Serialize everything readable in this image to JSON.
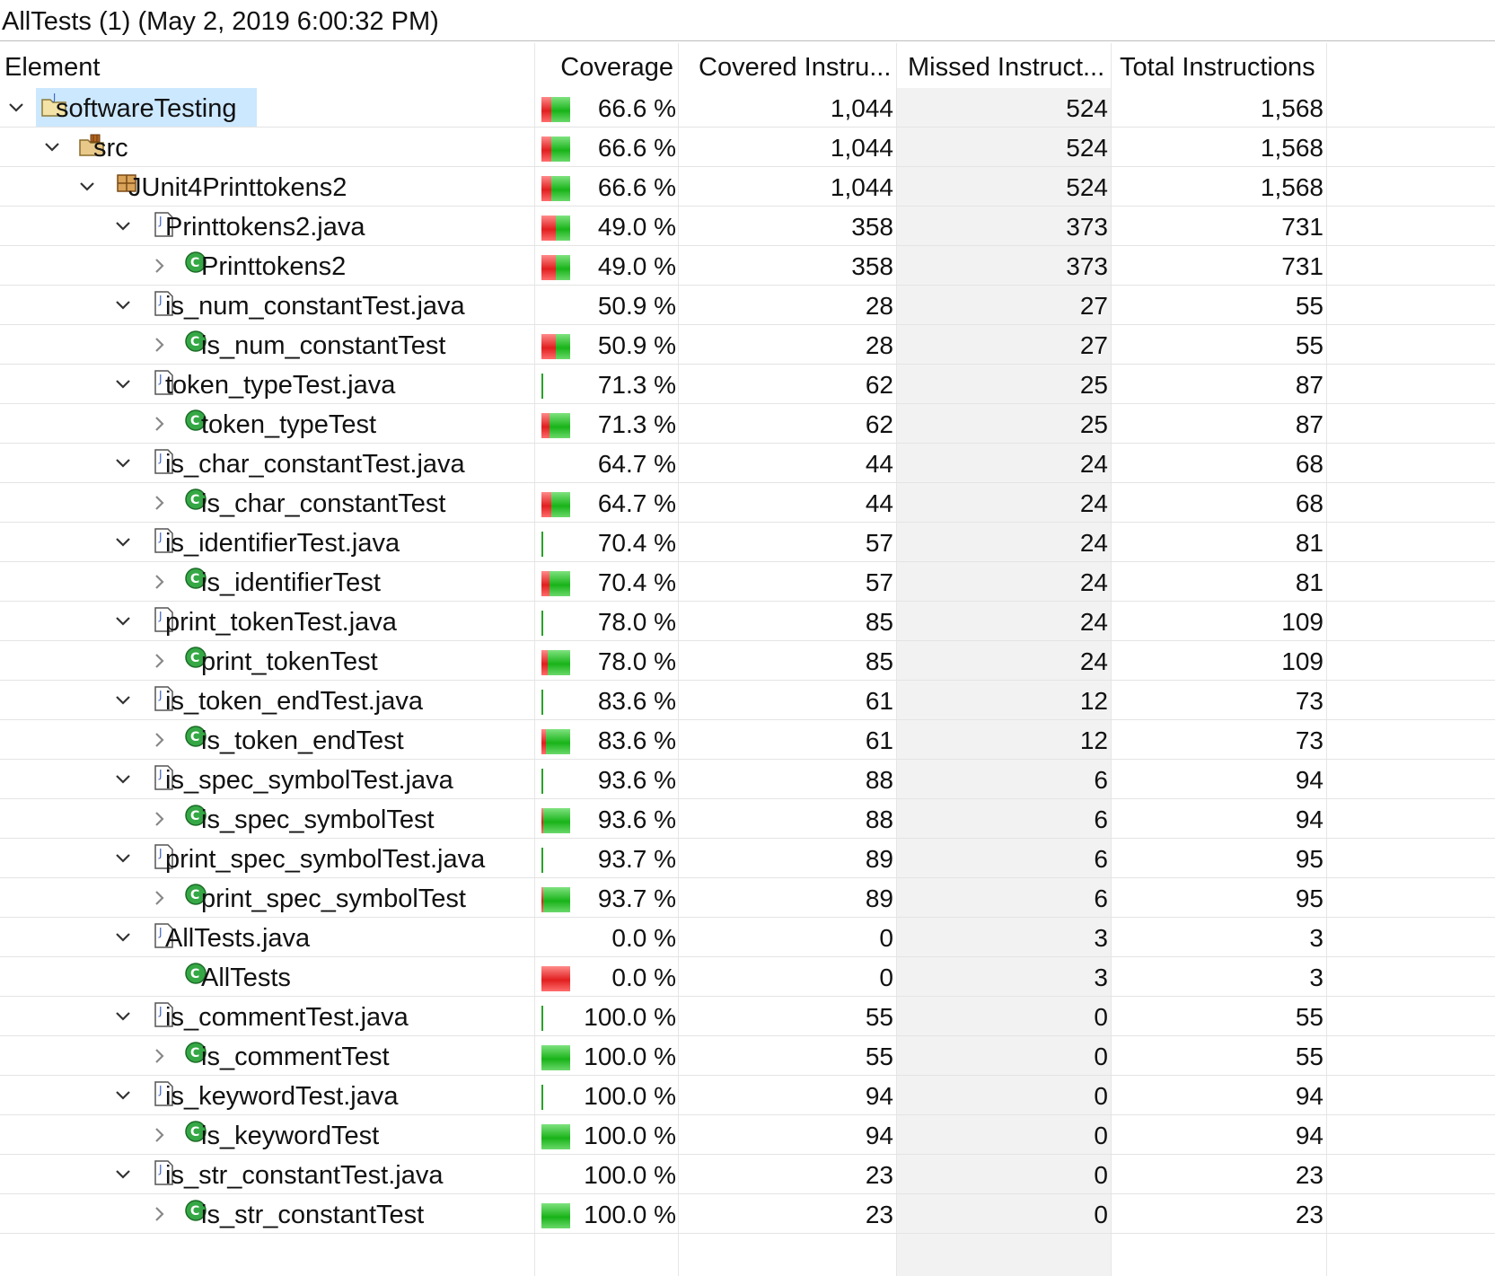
{
  "title": "AllTests (1) (May 2, 2019 6:00:32 PM)",
  "columns": {
    "element": "Element",
    "coverage": "Coverage",
    "covered": "Covered Instru...",
    "missed": "Missed Instruct...",
    "total": "Total Instructions"
  },
  "rows": [
    {
      "name": "softwareTesting",
      "kind": "project",
      "level": 0,
      "expander": "expanded",
      "selected": true,
      "bar": "full",
      "coverage_value": 66.6,
      "coverage": "66.6 %",
      "covered": "1,044",
      "missed": "524",
      "total": "1,568"
    },
    {
      "name": "src",
      "kind": "srcfolder",
      "level": 1,
      "expander": "expanded",
      "bar": "full",
      "coverage_value": 66.6,
      "coverage": "66.6 %",
      "covered": "1,044",
      "missed": "524",
      "total": "1,568"
    },
    {
      "name": "JUnit4Printtokens2",
      "kind": "package",
      "level": 2,
      "expander": "expanded",
      "bar": "full",
      "coverage_value": 66.6,
      "coverage": "66.6 %",
      "covered": "1,044",
      "missed": "524",
      "total": "1,568"
    },
    {
      "name": "Printtokens2.java",
      "kind": "javafile",
      "level": 3,
      "expander": "expanded",
      "bar": "full",
      "coverage_value": 49.0,
      "coverage": "49.0 %",
      "covered": "358",
      "missed": "373",
      "total": "731"
    },
    {
      "name": "Printtokens2",
      "kind": "class",
      "level": 4,
      "expander": "collapsed",
      "bar": "full",
      "coverage_value": 49.0,
      "coverage": "49.0 %",
      "covered": "358",
      "missed": "373",
      "total": "731"
    },
    {
      "name": "is_num_constantTest.java",
      "kind": "javafile",
      "level": 3,
      "expander": "expanded",
      "bar": "none",
      "coverage_value": 50.9,
      "coverage": "50.9 %",
      "covered": "28",
      "missed": "27",
      "total": "55"
    },
    {
      "name": "is_num_constantTest",
      "kind": "class",
      "level": 4,
      "expander": "collapsed",
      "bar": "full",
      "coverage_value": 50.9,
      "coverage": "50.9 %",
      "covered": "28",
      "missed": "27",
      "total": "55"
    },
    {
      "name": "token_typeTest.java",
      "kind": "javafile",
      "level": 3,
      "expander": "expanded",
      "bar": "thin",
      "coverage_value": 71.3,
      "coverage": "71.3 %",
      "covered": "62",
      "missed": "25",
      "total": "87"
    },
    {
      "name": "token_typeTest",
      "kind": "class",
      "level": 4,
      "expander": "collapsed",
      "bar": "full",
      "coverage_value": 71.3,
      "coverage": "71.3 %",
      "covered": "62",
      "missed": "25",
      "total": "87"
    },
    {
      "name": "is_char_constantTest.java",
      "kind": "javafile",
      "level": 3,
      "expander": "expanded",
      "bar": "none",
      "coverage_value": 64.7,
      "coverage": "64.7 %",
      "covered": "44",
      "missed": "24",
      "total": "68"
    },
    {
      "name": "is_char_constantTest",
      "kind": "class",
      "level": 4,
      "expander": "collapsed",
      "bar": "full",
      "coverage_value": 64.7,
      "coverage": "64.7 %",
      "covered": "44",
      "missed": "24",
      "total": "68"
    },
    {
      "name": "is_identifierTest.java",
      "kind": "javafile",
      "level": 3,
      "expander": "expanded",
      "bar": "thin",
      "coverage_value": 70.4,
      "coverage": "70.4 %",
      "covered": "57",
      "missed": "24",
      "total": "81"
    },
    {
      "name": "is_identifierTest",
      "kind": "class",
      "level": 4,
      "expander": "collapsed",
      "bar": "full",
      "coverage_value": 70.4,
      "coverage": "70.4 %",
      "covered": "57",
      "missed": "24",
      "total": "81"
    },
    {
      "name": "print_tokenTest.java",
      "kind": "javafile",
      "level": 3,
      "expander": "expanded",
      "bar": "thin",
      "coverage_value": 78.0,
      "coverage": "78.0 %",
      "covered": "85",
      "missed": "24",
      "total": "109"
    },
    {
      "name": "print_tokenTest",
      "kind": "class",
      "level": 4,
      "expander": "collapsed",
      "bar": "full",
      "coverage_value": 78.0,
      "coverage": "78.0 %",
      "covered": "85",
      "missed": "24",
      "total": "109"
    },
    {
      "name": "is_token_endTest.java",
      "kind": "javafile",
      "level": 3,
      "expander": "expanded",
      "bar": "thin",
      "coverage_value": 83.6,
      "coverage": "83.6 %",
      "covered": "61",
      "missed": "12",
      "total": "73"
    },
    {
      "name": "is_token_endTest",
      "kind": "class",
      "level": 4,
      "expander": "collapsed",
      "bar": "full",
      "coverage_value": 83.6,
      "coverage": "83.6 %",
      "covered": "61",
      "missed": "12",
      "total": "73"
    },
    {
      "name": "is_spec_symbolTest.java",
      "kind": "javafile",
      "level": 3,
      "expander": "expanded",
      "bar": "thin",
      "coverage_value": 93.6,
      "coverage": "93.6 %",
      "covered": "88",
      "missed": "6",
      "total": "94"
    },
    {
      "name": "is_spec_symbolTest",
      "kind": "class",
      "level": 4,
      "expander": "collapsed",
      "bar": "full",
      "coverage_value": 93.6,
      "coverage": "93.6 %",
      "covered": "88",
      "missed": "6",
      "total": "94"
    },
    {
      "name": "print_spec_symbolTest.java",
      "kind": "javafile",
      "level": 3,
      "expander": "expanded",
      "bar": "thin",
      "coverage_value": 93.7,
      "coverage": "93.7 %",
      "covered": "89",
      "missed": "6",
      "total": "95"
    },
    {
      "name": "print_spec_symbolTest",
      "kind": "class",
      "level": 4,
      "expander": "collapsed",
      "bar": "full",
      "coverage_value": 93.7,
      "coverage": "93.7 %",
      "covered": "89",
      "missed": "6",
      "total": "95"
    },
    {
      "name": "AllTests.java",
      "kind": "javafile",
      "level": 3,
      "expander": "expanded",
      "bar": "none",
      "coverage_value": 0.0,
      "coverage": "0.0 %",
      "covered": "0",
      "missed": "3",
      "total": "3"
    },
    {
      "name": "AllTests",
      "kind": "class",
      "level": 4,
      "expander": "none",
      "bar": "full",
      "coverage_value": 0.0,
      "coverage": "0.0 %",
      "covered": "0",
      "missed": "3",
      "total": "3"
    },
    {
      "name": "is_commentTest.java",
      "kind": "javafile",
      "level": 3,
      "expander": "expanded",
      "bar": "thin",
      "coverage_value": 100.0,
      "coverage": "100.0 %",
      "covered": "55",
      "missed": "0",
      "total": "55"
    },
    {
      "name": "is_commentTest",
      "kind": "class",
      "level": 4,
      "expander": "collapsed",
      "bar": "full",
      "coverage_value": 100.0,
      "coverage": "100.0 %",
      "covered": "55",
      "missed": "0",
      "total": "55"
    },
    {
      "name": "is_keywordTest.java",
      "kind": "javafile",
      "level": 3,
      "expander": "expanded",
      "bar": "thin",
      "coverage_value": 100.0,
      "coverage": "100.0 %",
      "covered": "94",
      "missed": "0",
      "total": "94"
    },
    {
      "name": "is_keywordTest",
      "kind": "class",
      "level": 4,
      "expander": "collapsed",
      "bar": "full",
      "coverage_value": 100.0,
      "coverage": "100.0 %",
      "covered": "94",
      "missed": "0",
      "total": "94"
    },
    {
      "name": "is_str_constantTest.java",
      "kind": "javafile",
      "level": 3,
      "expander": "expanded",
      "bar": "none",
      "coverage_value": 100.0,
      "coverage": "100.0 %",
      "covered": "23",
      "missed": "0",
      "total": "23"
    },
    {
      "name": "is_str_constantTest",
      "kind": "class",
      "level": 4,
      "expander": "collapsed",
      "bar": "full",
      "coverage_value": 100.0,
      "coverage": "100.0 %",
      "covered": "23",
      "missed": "0",
      "total": "23"
    }
  ]
}
